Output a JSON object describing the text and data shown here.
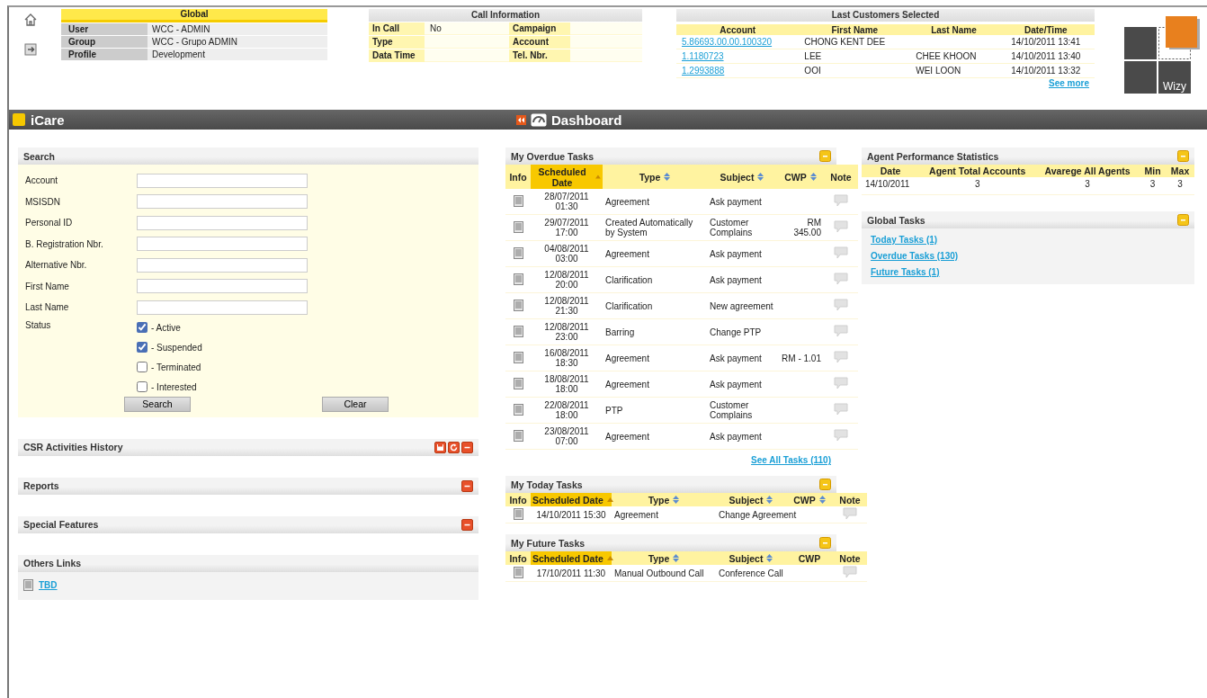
{
  "global": {
    "title": "Global",
    "rows": [
      {
        "label": "User",
        "value": "WCC - ADMIN"
      },
      {
        "label": "Group",
        "value": "WCC - Grupo ADMIN"
      },
      {
        "label": "Profile",
        "value": "Development"
      }
    ]
  },
  "call_information": {
    "title": "Call Information",
    "rows": [
      {
        "label": "In Call",
        "value": "No",
        "label_2": "Campaign"
      },
      {
        "label": "Type",
        "label_2": "Account"
      },
      {
        "label": "Data Time",
        "label_2": "Tel. Nbr."
      }
    ]
  },
  "last_customers": {
    "title": "Last Customers Selected",
    "columns": [
      "Account",
      "First Name",
      "Last Name",
      "Date/Time"
    ],
    "rows": [
      {
        "account": "5.86693.00.00.100320",
        "first_name": "CHONG KENT DEE",
        "date_time": "14/10/2011 13:41"
      },
      {
        "account": "1.1180723",
        "first_name": "LEE",
        "last_name": "CHEE KHOON",
        "date_time": "14/10/2011 13:40"
      },
      {
        "account": "1.2993888",
        "first_name": "OOI",
        "last_name": "WEI LOON",
        "date_time": "14/10/2011 13:32"
      }
    ],
    "see_more": "See more"
  },
  "logo": {
    "label": "Wizy"
  },
  "app_bar": {
    "app_title": "iCare",
    "page_title": "Dashboard"
  },
  "search": {
    "title": "Search",
    "fields": [
      {
        "label": "Account"
      },
      {
        "label": "MSISDN"
      },
      {
        "label": "Personal ID"
      },
      {
        "label": "B. Registration Nbr."
      },
      {
        "label": "Alternative Nbr."
      },
      {
        "label": "First Name"
      },
      {
        "label": "Last Name"
      }
    ],
    "status_label": "Status",
    "statuses": [
      {
        "label": "- Active",
        "checked": true
      },
      {
        "label": "- Suspended",
        "checked": true
      },
      {
        "label": "- Terminated",
        "checked": false
      },
      {
        "label": "- Interested",
        "checked": false
      }
    ],
    "buttons": [
      "Search",
      "Clear"
    ]
  },
  "left_panels": [
    {
      "title": "CSR Activities History",
      "kind": "history"
    },
    {
      "title": "Reports",
      "kind": "collapsed"
    },
    {
      "title": "Special Features",
      "kind": "collapsed"
    },
    {
      "title": "Others Links",
      "kind": "links",
      "links": [
        "TBD"
      ]
    }
  ],
  "overdue_tasks": {
    "title": "My Overdue Tasks",
    "columns": [
      {
        "label": "Info",
        "kind": "plain"
      },
      {
        "label": "Scheduled Date",
        "kind": "sorted"
      },
      {
        "label": "Type",
        "kind": "sortable"
      },
      {
        "label": "Subject",
        "kind": "sortable"
      },
      {
        "label": "CWP",
        "kind": "sortable"
      },
      {
        "label": "Note",
        "kind": "plain"
      }
    ],
    "rows": [
      {
        "date": "28/07/2011 01:30",
        "type": "Agreement",
        "subject": "Ask payment"
      },
      {
        "date": "29/07/2011 17:00",
        "type": "Created Automatically by System",
        "subject": "Customer Complains",
        "cwp": "RM 345.00"
      },
      {
        "date": "04/08/2011 03:00",
        "type": "Agreement",
        "subject": "Ask payment"
      },
      {
        "date": "12/08/2011 20:00",
        "type": "Clarification",
        "subject": "Ask payment"
      },
      {
        "date": "12/08/2011 21:30",
        "type": "Clarification",
        "subject": "New agreement"
      },
      {
        "date": "12/08/2011 23:00",
        "type": "Barring",
        "subject": "Change PTP"
      },
      {
        "date": "16/08/2011 18:30",
        "type": "Agreement",
        "subject": "Ask payment",
        "cwp": "RM - 1.01"
      },
      {
        "date": "18/08/2011 18:00",
        "type": "Agreement",
        "subject": "Ask payment"
      },
      {
        "date": "22/08/2011 18:00",
        "type": "PTP",
        "subject": "Customer Complains"
      },
      {
        "date": "23/08/2011 07:00",
        "type": "Agreement",
        "subject": "Ask payment"
      }
    ],
    "link": "See All Tasks (110)"
  },
  "today_tasks": {
    "title": "My Today Tasks",
    "columns": [
      {
        "label": "Info",
        "kind": "plain"
      },
      {
        "label": "Scheduled Date",
        "kind": "sorted"
      },
      {
        "label": "Type",
        "kind": "sortable"
      },
      {
        "label": "Subject",
        "kind": "sortable"
      },
      {
        "label": "CWP",
        "kind": "sortable"
      },
      {
        "label": "Note",
        "kind": "plain"
      }
    ],
    "rows": [
      {
        "date": "14/10/2011 15:30",
        "type": "Agreement",
        "subject": "Change Agreement"
      }
    ]
  },
  "future_tasks": {
    "title": "My Future Tasks",
    "columns": [
      {
        "label": "Info",
        "kind": "plain"
      },
      {
        "label": "Scheduled Date",
        "kind": "sorted"
      },
      {
        "label": "Type",
        "kind": "sortable"
      },
      {
        "label": "Subject",
        "kind": "sortable"
      },
      {
        "label": "CWP",
        "kind": "plain"
      },
      {
        "label": "Note",
        "kind": "plain"
      }
    ],
    "rows": [
      {
        "date": "17/10/2011 11:30",
        "type": "Manual Outbound Call",
        "subject": "Conference Call"
      }
    ]
  },
  "agent_statistics": {
    "title": "Agent Performance Statistics",
    "columns": [
      "Date",
      "Agent Total Accounts",
      "Avarege All Agents",
      "Min",
      "Max"
    ],
    "rows": [
      [
        "14/10/2011",
        "3",
        "3",
        "3",
        "3"
      ]
    ]
  },
  "global_tasks": {
    "title": "Global Tasks",
    "links": [
      "Today Tasks (1)",
      "Overdue Tasks (130)",
      "Future Tasks (1)"
    ]
  }
}
